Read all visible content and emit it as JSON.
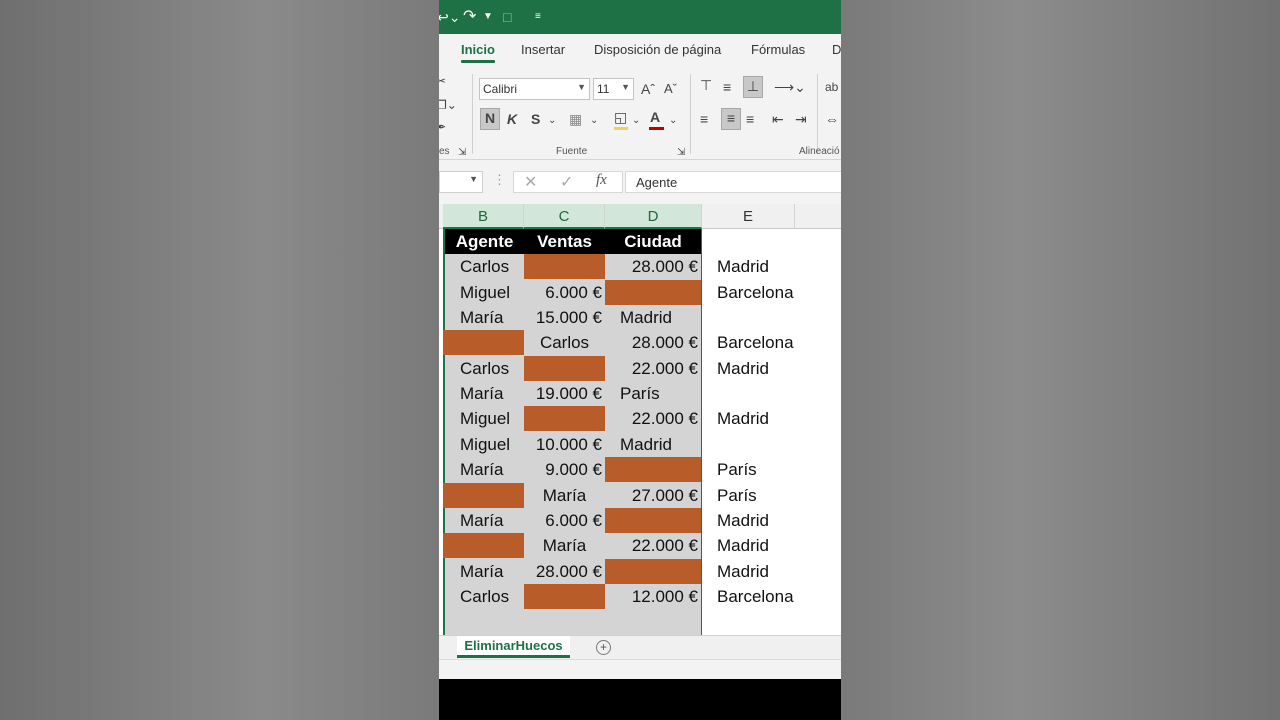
{
  "window": {
    "brand_color": "#1e7145"
  },
  "titlebar": {
    "undo_icon": "undo-icon",
    "redo_icon": "redo-icon",
    "clipboard_icon": "clipboard-icon",
    "customize_icon": "dropdown-icon"
  },
  "tabs": [
    {
      "label": "Inicio",
      "active": true
    },
    {
      "label": "Insertar"
    },
    {
      "label": "Disposición de página"
    },
    {
      "label": "Fórmulas"
    },
    {
      "label": "D"
    }
  ],
  "ribbon": {
    "clipboard_group_label": "es",
    "font_name": "Calibri",
    "font_size": "11",
    "bold_label": "N",
    "italic_label": "K",
    "strike_label": "S",
    "font_group_label": "Fuente",
    "alignment_group_label": "Alineació",
    "fill_color": "#f2d15a",
    "font_color": "#c00000"
  },
  "formula_bar": {
    "value": "Agente"
  },
  "columns": [
    "B",
    "C",
    "D",
    "E"
  ],
  "table": {
    "headers": [
      "Agente",
      "Ventas",
      "Ciudad"
    ],
    "fill_color": "#b85c2a",
    "rows": [
      [
        "Carlos",
        "",
        "28.000 €",
        "Madrid"
      ],
      [
        "Miguel",
        "6.000 €",
        "",
        "Barcelona"
      ],
      [
        "María",
        "15.000 €",
        "Madrid",
        ""
      ],
      [
        "",
        "Carlos",
        "28.000 €",
        "Barcelona"
      ],
      [
        "Carlos",
        "",
        "22.000 €",
        "Madrid"
      ],
      [
        "María",
        "19.000 €",
        "París",
        ""
      ],
      [
        "Miguel",
        "",
        "22.000 €",
        "Madrid"
      ],
      [
        "Miguel",
        "10.000 €",
        "Madrid",
        ""
      ],
      [
        "María",
        "9.000 €",
        "",
        "París"
      ],
      [
        "",
        "María",
        "27.000 €",
        "París"
      ],
      [
        "María",
        "6.000 €",
        "",
        "Madrid"
      ],
      [
        "",
        "María",
        "22.000 €",
        "Madrid"
      ],
      [
        "María",
        "28.000 €",
        "",
        "Madrid"
      ],
      [
        "Carlos",
        "",
        "12.000 €",
        "Barcelona"
      ]
    ]
  },
  "sheet": {
    "tab_label": "EliminarHuecos",
    "add_label": "+"
  }
}
